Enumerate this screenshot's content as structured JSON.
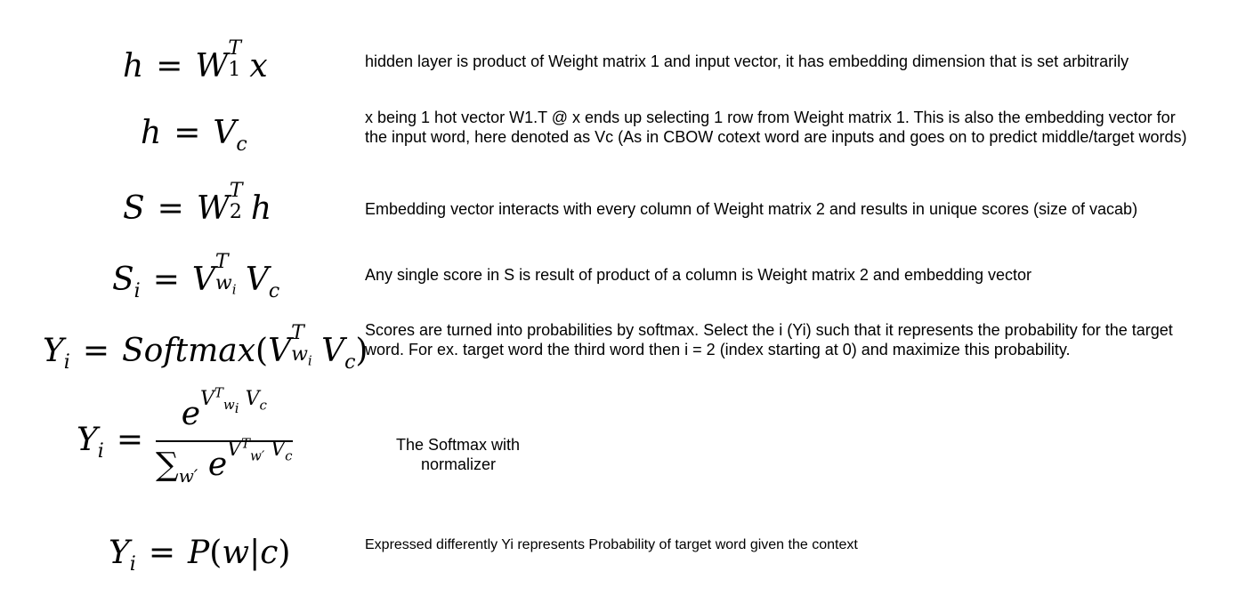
{
  "rows": [
    {
      "note": "hidden layer is product of Weight matrix 1 and input vector, it has embedding dimension that is set arbitrarily"
    },
    {
      "note_line1": "x being 1 hot vector W1.T @ x  ends up selecting 1 row from Weight matrix 1.  This is also the embedding vector for",
      "note_line2": "the input word, here denoted as Vc (As in CBOW cotext word are inputs and goes on to predict middle/target words)"
    },
    {
      "note": "Embedding vector interacts with every column of Weight matrix 2 and results in unique scores (size of vacab)"
    },
    {
      "note": "Any single score in S is result of product of a column is Weight matrix 2 and embedding vector"
    },
    {
      "note_line1": "Scores are turned into probabilities by softmax. Select the i (Yi) such that it represents the probability for the target",
      "note_line2": "word. For ex. target word the third word then i = 2 (index starting at 0) and maximize this probability."
    },
    {
      "note_line1": "The Softmax with",
      "note_line2": "normalizer"
    },
    {
      "note": "Expressed differently Yi represents Probability of target word given the context"
    }
  ]
}
